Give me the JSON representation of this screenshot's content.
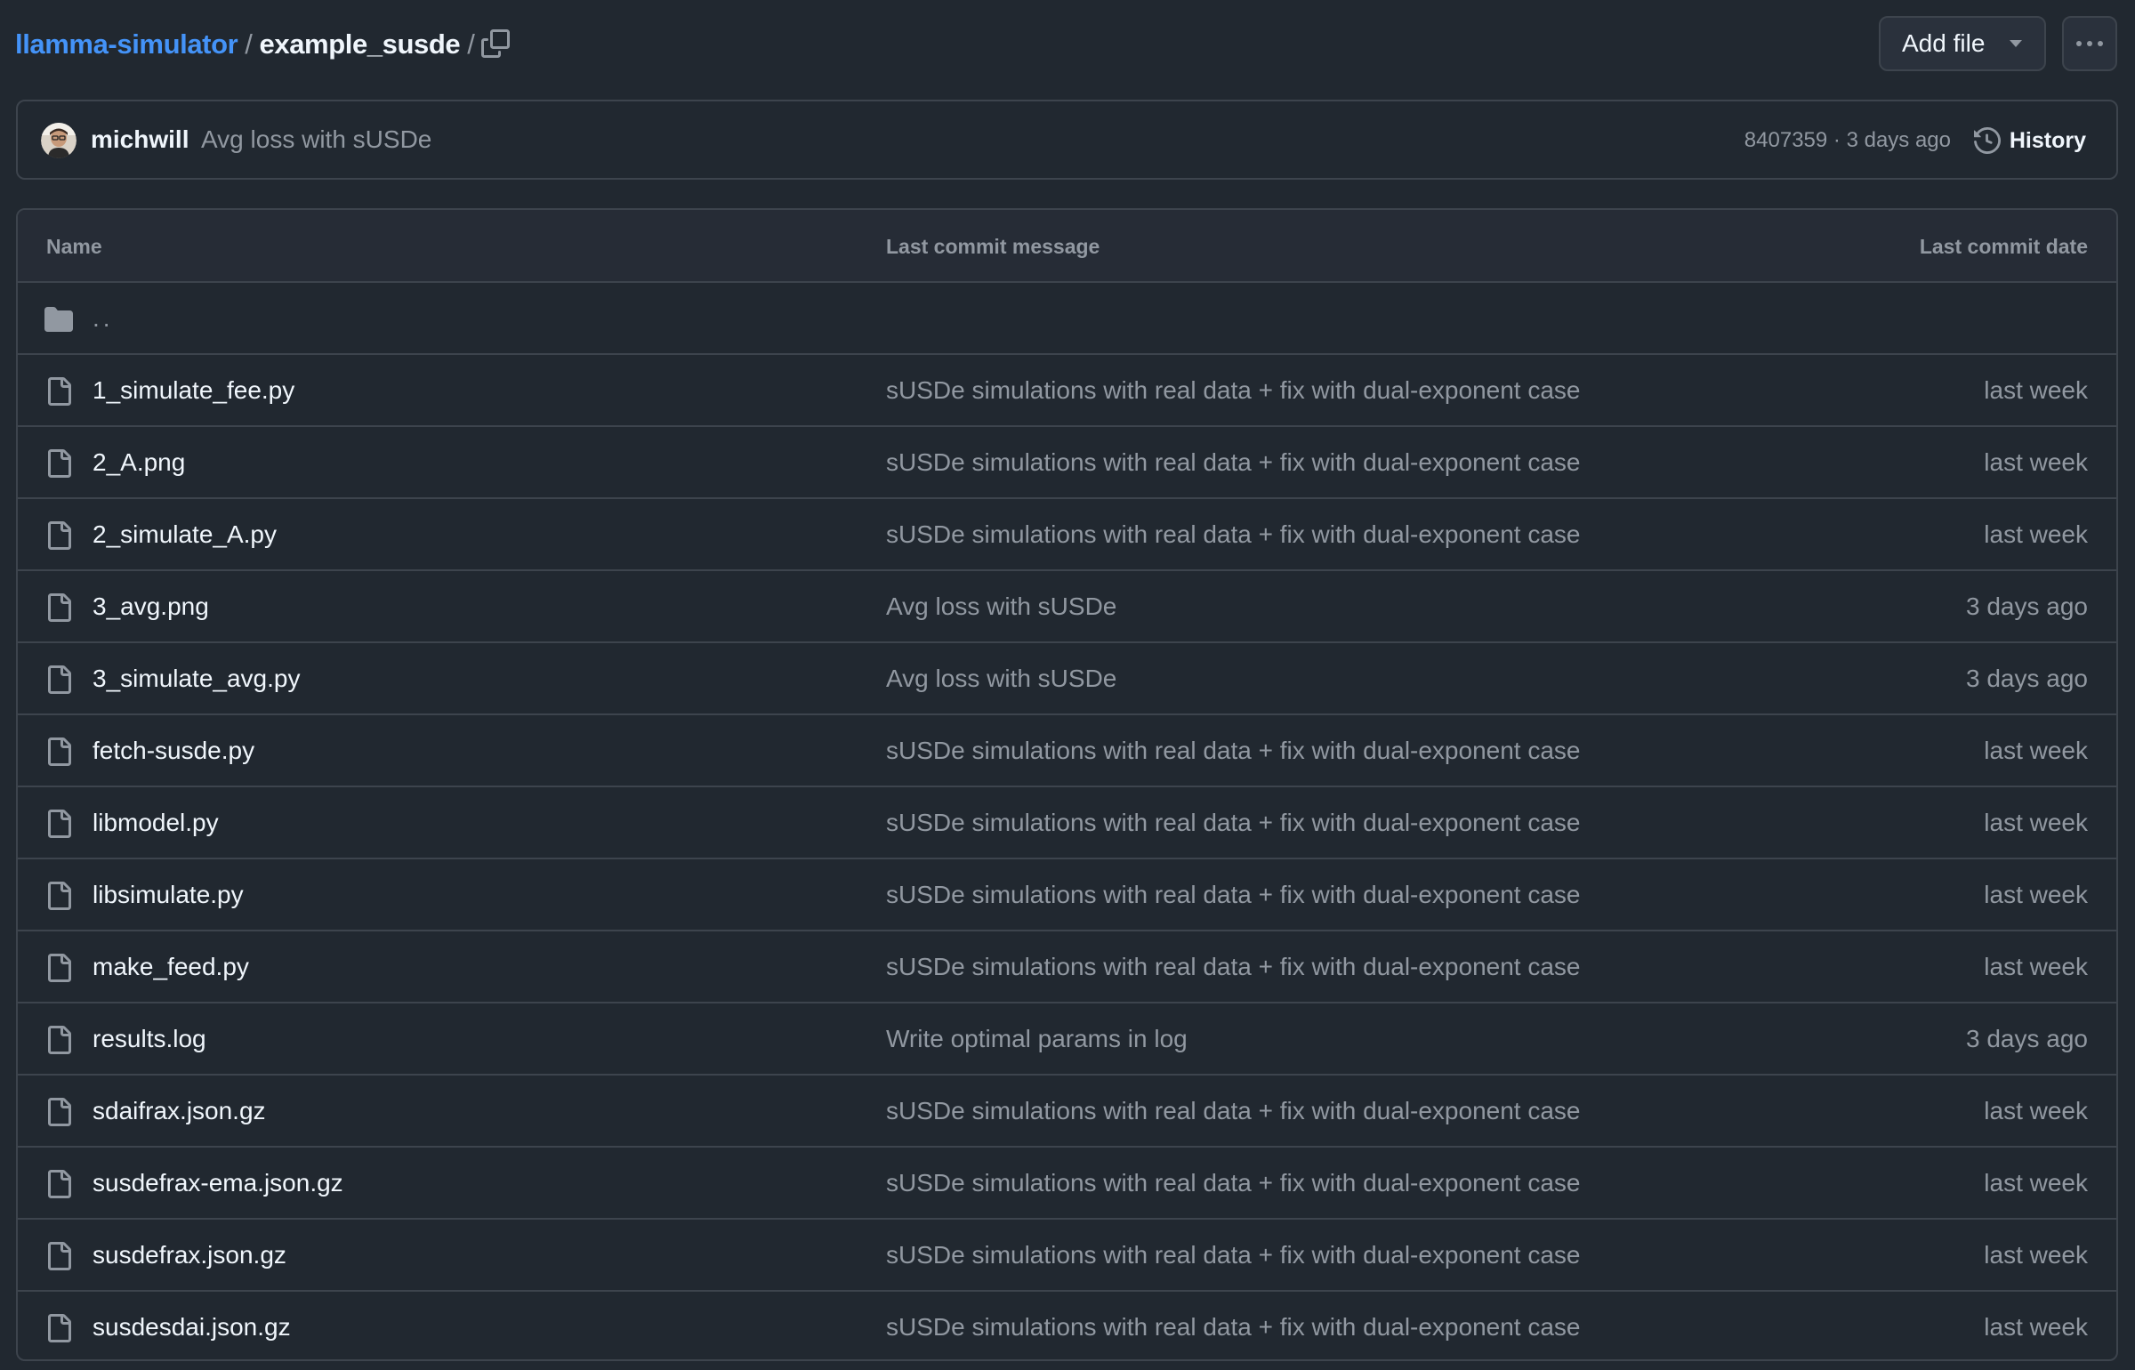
{
  "breadcrumb": {
    "repo": "llamma-simulator",
    "separator": "/",
    "directory": "example_susde",
    "trailing_separator": "/"
  },
  "toolbar": {
    "add_file_label": "Add file",
    "more_options_icon": "kebab-horizontal-icon",
    "copy_path_icon": "copy-icon"
  },
  "latest_commit": {
    "author": "michwill",
    "message": "Avg loss with sUSDe",
    "sha": "8407359",
    "separator": "·",
    "time": "3 days ago",
    "history_label": "History",
    "history_icon": "history-icon"
  },
  "table": {
    "headers": {
      "name": "Name",
      "message": "Last commit message",
      "date": "Last commit date"
    },
    "parent_dir": "..",
    "rows": [
      {
        "name": "1_simulate_fee.py",
        "message": "sUSDe simulations with real data + fix with dual-exponent case",
        "date": "last week"
      },
      {
        "name": "2_A.png",
        "message": "sUSDe simulations with real data + fix with dual-exponent case",
        "date": "last week"
      },
      {
        "name": "2_simulate_A.py",
        "message": "sUSDe simulations with real data + fix with dual-exponent case",
        "date": "last week"
      },
      {
        "name": "3_avg.png",
        "message": "Avg loss with sUSDe",
        "date": "3 days ago"
      },
      {
        "name": "3_simulate_avg.py",
        "message": "Avg loss with sUSDe",
        "date": "3 days ago"
      },
      {
        "name": "fetch-susde.py",
        "message": "sUSDe simulations with real data + fix with dual-exponent case",
        "date": "last week"
      },
      {
        "name": "libmodel.py",
        "message": "sUSDe simulations with real data + fix with dual-exponent case",
        "date": "last week"
      },
      {
        "name": "libsimulate.py",
        "message": "sUSDe simulations with real data + fix with dual-exponent case",
        "date": "last week"
      },
      {
        "name": "make_feed.py",
        "message": "sUSDe simulations with real data + fix with dual-exponent case",
        "date": "last week"
      },
      {
        "name": "results.log",
        "message": "Write optimal params in log",
        "date": "3 days ago"
      },
      {
        "name": "sdaifrax.json.gz",
        "message": "sUSDe simulations with real data + fix with dual-exponent case",
        "date": "last week"
      },
      {
        "name": "susdefrax-ema.json.gz",
        "message": "sUSDe simulations with real data + fix with dual-exponent case",
        "date": "last week"
      },
      {
        "name": "susdefrax.json.gz",
        "message": "sUSDe simulations with real data + fix with dual-exponent case",
        "date": "last week"
      },
      {
        "name": "susdesdai.json.gz",
        "message": "sUSDe simulations with real data + fix with dual-exponent case",
        "date": "last week"
      }
    ]
  },
  "colors": {
    "background": "#212830",
    "header_background": "#262c36",
    "border": "#3d444d",
    "link": "#4493f8",
    "text_primary": "#f0f6fc",
    "text_muted": "#9198a1"
  }
}
